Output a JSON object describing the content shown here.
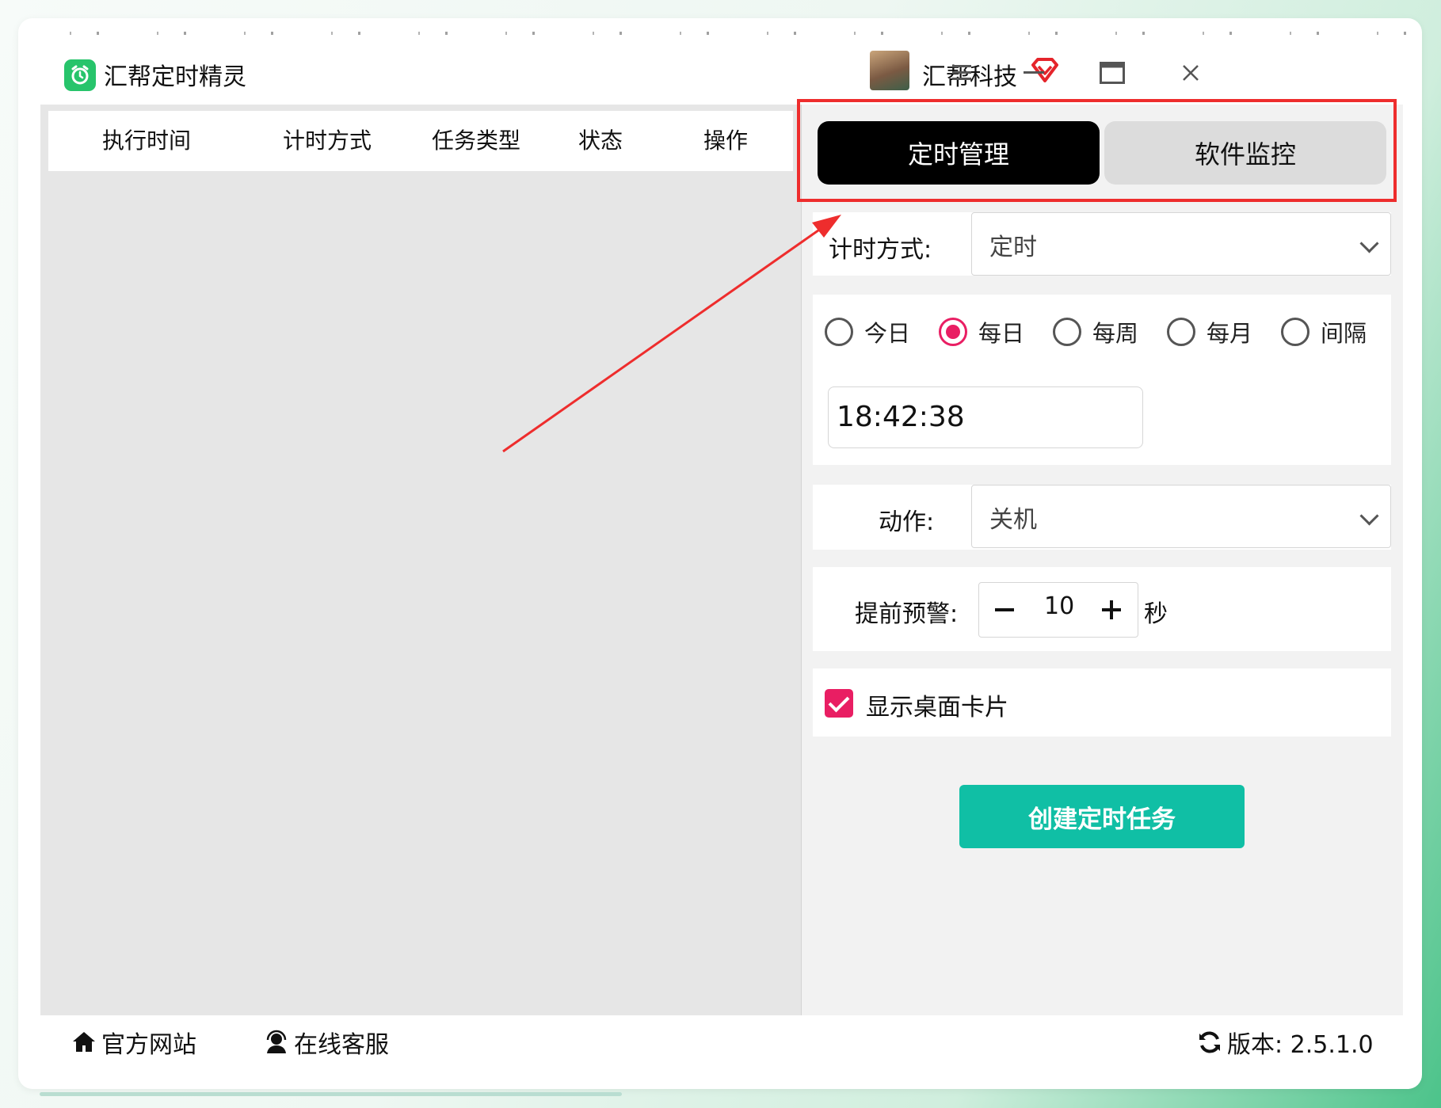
{
  "window": {
    "app_title": "汇帮定时精灵",
    "brand_name": "汇帮科技",
    "icons": [
      "alarm-clock-icon",
      "vip-diamond-icon",
      "menu-icon",
      "minimize-icon",
      "maximize-icon",
      "close-icon"
    ]
  },
  "task_table": {
    "columns": [
      "执行时间",
      "计时方式",
      "任务类型",
      "状态",
      "操作"
    ]
  },
  "tabs": [
    {
      "label": "定时管理",
      "active": true
    },
    {
      "label": "软件监控",
      "active": false
    }
  ],
  "form": {
    "timing_mode_label": "计时方式:",
    "timing_mode_value": "定时",
    "frequency_options": [
      {
        "label": "今日",
        "selected": false
      },
      {
        "label": "每日",
        "selected": true
      },
      {
        "label": "每周",
        "selected": false
      },
      {
        "label": "每月",
        "selected": false
      },
      {
        "label": "间隔",
        "selected": false
      }
    ],
    "time_value": "18:42:38",
    "action_label": "动作:",
    "action_value": "关机",
    "warning_label": "提前预警:",
    "warning_value": "10",
    "warning_unit": "秒",
    "show_card_label": "显示桌面卡片",
    "show_card_checked": true,
    "create_button": "创建定时任务"
  },
  "footer": {
    "website": "官方网站",
    "support": "在线客服",
    "version": "版本:  2.5.1.0"
  },
  "colors": {
    "accent_pink": "#e91e63",
    "create_button": "#10bfa5",
    "highlight_box": "#ee2d2d",
    "app_logo": "#27c46b"
  }
}
